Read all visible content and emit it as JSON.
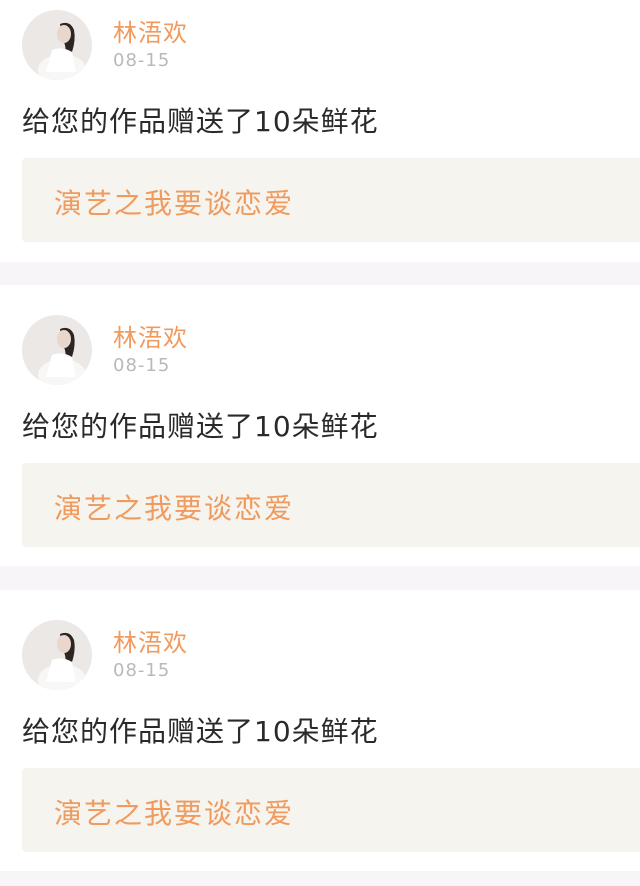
{
  "feed": {
    "items": [
      {
        "username": "林浯欢",
        "date": "08-15",
        "message": "给您的作品赠送了10朵鲜花",
        "work_title": "演艺之我要谈恋爱"
      },
      {
        "username": "林浯欢",
        "date": "08-15",
        "message": "给您的作品赠送了10朵鲜花",
        "work_title": "演艺之我要谈恋爱"
      },
      {
        "username": "林浯欢",
        "date": "08-15",
        "message": "给您的作品赠送了10朵鲜花",
        "work_title": "演艺之我要谈恋爱"
      }
    ]
  },
  "colors": {
    "accent_orange": "#f09a5e",
    "date_gray": "#b9b9b9",
    "message_text": "#2a2a2a",
    "work_box_bg": "#f5f4ee",
    "page_bg": "#f7f5f7",
    "card_bg": "#ffffff"
  },
  "icons": {
    "avatar": "user-avatar-photo"
  }
}
